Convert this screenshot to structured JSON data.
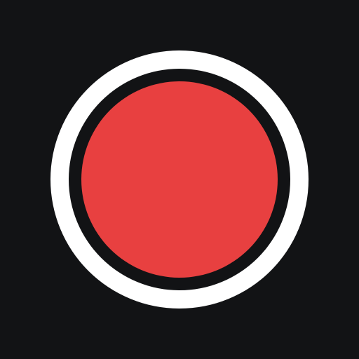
{
  "app_icon": {
    "icon_name": "record-icon",
    "colors": {
      "background": "#121315",
      "outer_ring": "#FFFFFF",
      "inner_gap": "#121315",
      "record_dot": "#E84040"
    }
  }
}
